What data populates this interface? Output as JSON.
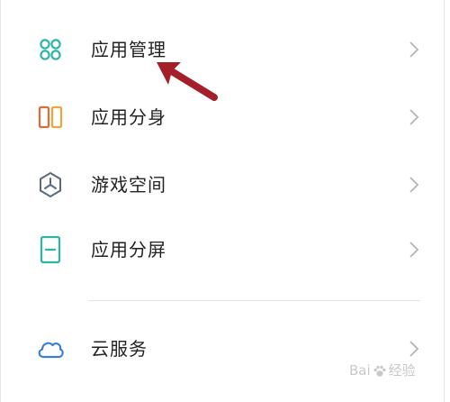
{
  "settings_list": {
    "items": [
      {
        "label": "应用管理",
        "icon": "app-grid-icon",
        "color": "#2bb5a2"
      },
      {
        "label": "应用分身",
        "icon": "app-clone-icon",
        "color": "#e4833b"
      },
      {
        "label": "游戏空间",
        "icon": "game-space-icon",
        "color": "#5a6a7a"
      },
      {
        "label": "应用分屏",
        "icon": "split-screen-icon",
        "color": "#2bb5a2"
      },
      {
        "label": "云服务",
        "icon": "cloud-icon",
        "color": "#3b7fd4"
      }
    ]
  },
  "annotation": {
    "arrow_color": "#a31f2a"
  },
  "watermark": {
    "brand_left": "Bai",
    "brand_right": "经验"
  }
}
